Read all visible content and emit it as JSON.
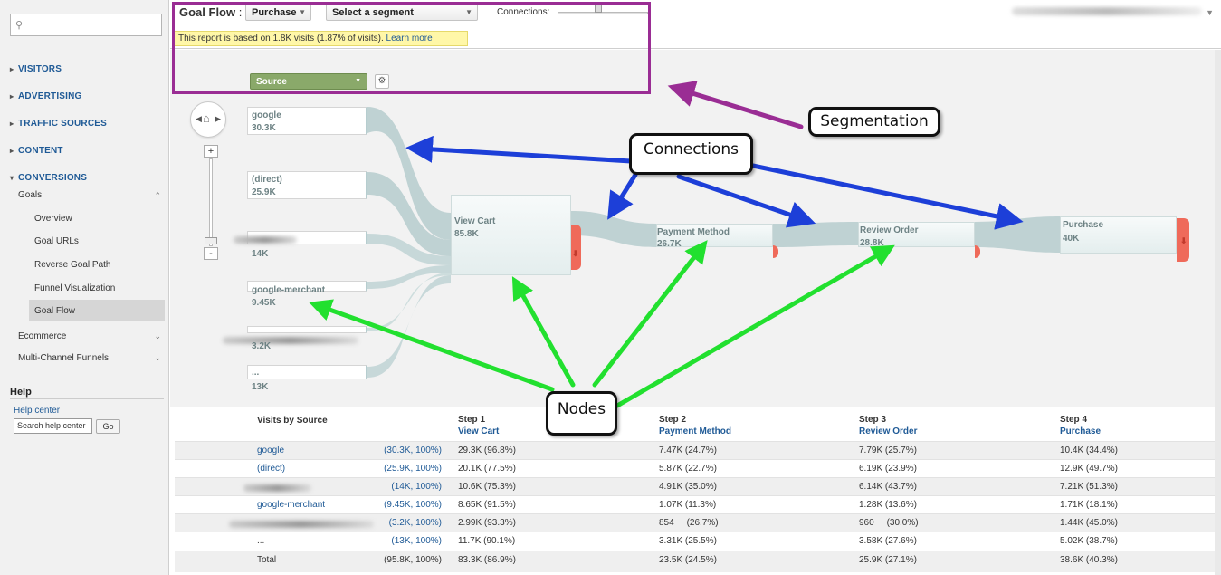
{
  "sidebar": {
    "search_placeholder": "",
    "sections": [
      {
        "label": "VISITORS"
      },
      {
        "label": "ADVERTISING"
      },
      {
        "label": "TRAFFIC SOURCES"
      },
      {
        "label": "CONTENT"
      },
      {
        "label": "CONVERSIONS"
      }
    ],
    "goals_label": "Goals",
    "goals_items": [
      {
        "label": "Overview"
      },
      {
        "label": "Goal URLs"
      },
      {
        "label": "Reverse Goal Path"
      },
      {
        "label": "Funnel Visualization"
      },
      {
        "label": "Goal Flow"
      }
    ],
    "ecommerce_label": "Ecommerce",
    "mcf_label": "Multi-Channel Funnels",
    "help": {
      "title": "Help",
      "link": "Help center",
      "search_value": "Search help center",
      "go_label": "Go"
    }
  },
  "header": {
    "title": "Goal Flow",
    "colon": ":",
    "goal_select": "Purchase",
    "segment_select": "Select a segment",
    "connections_label": "Connections:",
    "notice_text": "This report is based on 1.8K visits (1.87% of visits).",
    "notice_link": "Learn more"
  },
  "flow": {
    "dimension_select": "Source",
    "sources": [
      {
        "name": "google",
        "value": "30.3K"
      },
      {
        "name": "(direct)",
        "value": "25.9K"
      },
      {
        "name": "",
        "value": "14K"
      },
      {
        "name": "google-merchant",
        "value": "9.45K"
      },
      {
        "name": "",
        "value": "3.2K"
      },
      {
        "name": "...",
        "value": "13K"
      }
    ],
    "steps": [
      {
        "name": "View Cart",
        "value": "85.8K"
      },
      {
        "name": "Payment Method",
        "value": "26.7K"
      },
      {
        "name": "Review Order",
        "value": "28.8K"
      },
      {
        "name": "Purchase",
        "value": "40K"
      }
    ],
    "drop_arrow": "⬇"
  },
  "annotations": {
    "segmentation": "Segmentation",
    "connections": "Connections",
    "nodes": "Nodes",
    "colors": {
      "purple": "#9a2d94",
      "blue": "#1d3fd8",
      "green": "#22e02f"
    }
  },
  "table": {
    "dimension_header": "Visits by Source",
    "steps": [
      {
        "label": "Step 1",
        "name": "View Cart"
      },
      {
        "label": "Step 2",
        "name": "Payment Method"
      },
      {
        "label": "Step 3",
        "name": "Review Order"
      },
      {
        "label": "Step 4",
        "name": "Purchase"
      }
    ],
    "rows": [
      {
        "source": "google",
        "visits": "(30.3K, 100%)",
        "s1": "29.3K (96.8%)",
        "s2": "7.47K (24.7%)",
        "s3": "7.79K (25.7%)",
        "s4": "10.4K (34.4%)"
      },
      {
        "source": "(direct)",
        "visits": "(25.9K, 100%)",
        "s1": "20.1K (77.5%)",
        "s2": "5.87K (22.7%)",
        "s3": "6.19K (23.9%)",
        "s4": "12.9K (49.7%)"
      },
      {
        "source": "",
        "visits": "(14K, 100%)",
        "s1": "10.6K (75.3%)",
        "s2": "4.91K (35.0%)",
        "s3": "6.14K (43.7%)",
        "s4": "7.21K (51.3%)"
      },
      {
        "source": "google-merchant",
        "visits": "(9.45K, 100%)",
        "s1": "8.65K (91.5%)",
        "s2": "1.07K (11.3%)",
        "s3": "1.28K (13.6%)",
        "s4": "1.71K (18.1%)"
      },
      {
        "source": "",
        "visits": "(3.2K, 100%)",
        "s1": "2.99K (93.3%)",
        "s2": "854     (26.7%)",
        "s3": "960     (30.0%)",
        "s4": "1.44K (45.0%)"
      },
      {
        "source": "...",
        "visits": "(13K, 100%)",
        "s1": "11.7K (90.1%)",
        "s2": "3.31K (25.5%)",
        "s3": "3.58K (27.6%)",
        "s4": "5.02K (38.7%)"
      },
      {
        "source": "Total",
        "visits": "(95.8K, 100%)",
        "s1": "83.3K (86.9%)",
        "s2": "23.5K (24.5%)",
        "s3": "25.9K (27.1%)",
        "s4": "38.6K (40.3%)"
      }
    ]
  }
}
